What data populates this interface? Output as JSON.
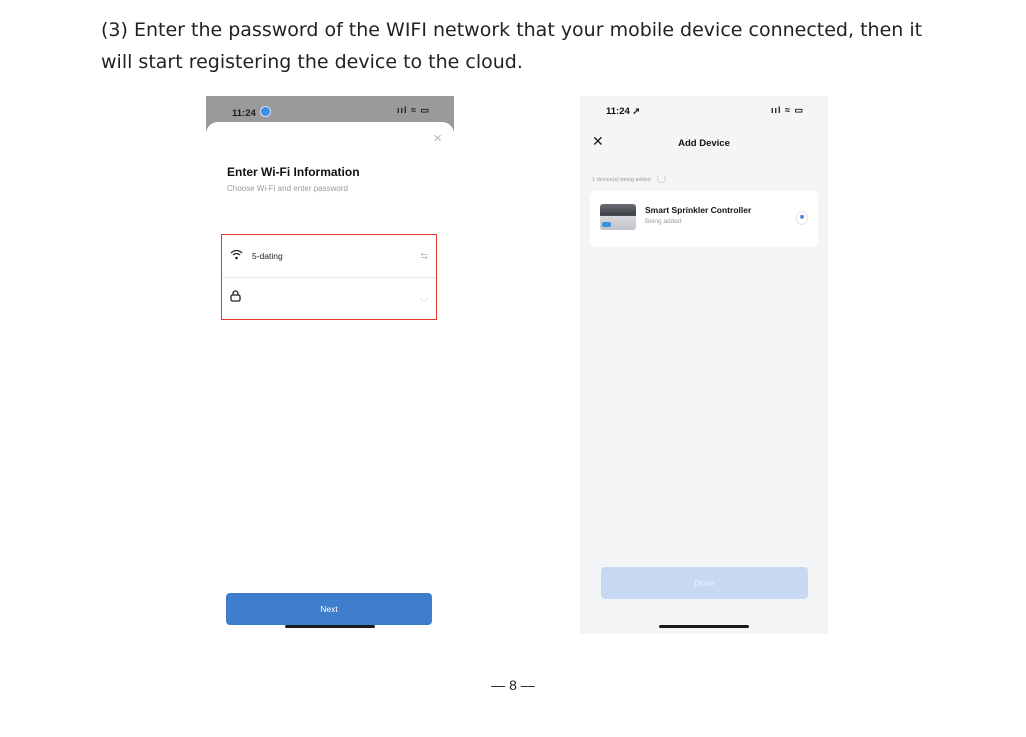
{
  "instruction": {
    "line1": "(3) Enter the password of the WIFI network that your mobile device connected, then it",
    "line2": "will start registering the device to the cloud."
  },
  "phone_left": {
    "status_time": "11:24",
    "status_icons": "ııl ≈ ▭",
    "close_glyph": "×",
    "title": "Enter Wi-Fi Information",
    "subtitle": "Choose Wi-Fi and enter password",
    "wifi_name": "5-dating",
    "switch_glyph": "⇆",
    "password_value": "",
    "eye_glyph": "◡",
    "next_label": "Next",
    "icons": [
      "wifi-icon",
      "lock-icon",
      "switch-network-icon",
      "hide-password-icon",
      "close-icon"
    ],
    "highlight_color": "#e0362c",
    "accent_color": "#3e7ecd"
  },
  "phone_right": {
    "status_time": "11:24 ➚",
    "status_icons": "ııl ≈ ▭",
    "close_glyph": "✕",
    "title": "Add Device",
    "adding_status": "1 device(s) being added",
    "device_name": "Smart Sprinkler Controller",
    "device_status": "Being added",
    "indicator_glyph": "■",
    "done_label": "Done",
    "icons": [
      "close-icon",
      "spinner-icon",
      "device-image",
      "status-indicator-icon"
    ],
    "button_color": "#c7d9f2"
  },
  "page_number": "— 8 —"
}
